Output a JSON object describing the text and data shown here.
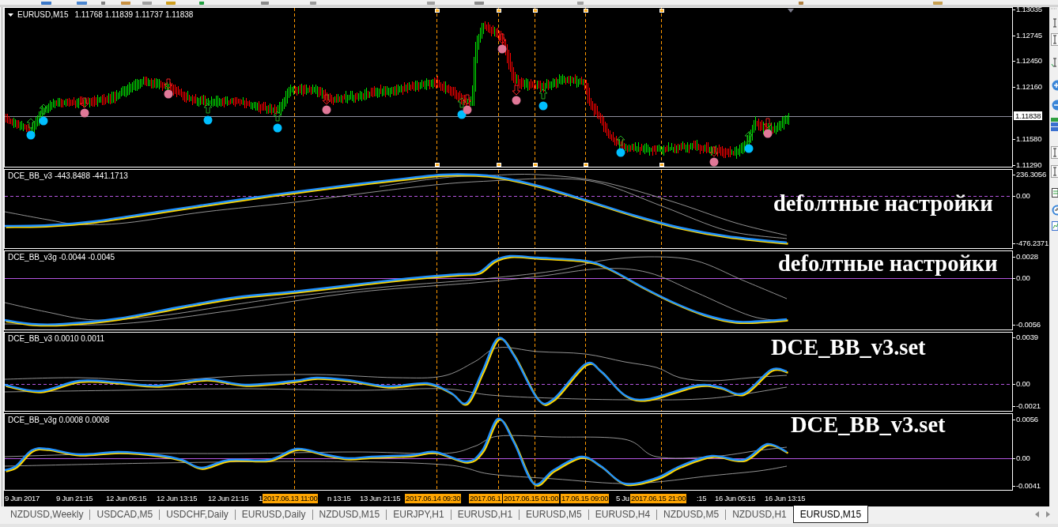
{
  "chart": {
    "panes": [
      {
        "kind": "price",
        "title": "EURUSD,M15",
        "quote": "1.11768 1.11839 1.11737 1.11838",
        "axis_labels": [
          "1.13035",
          "1.12745",
          "1.12450",
          "1.12160",
          "1.11580",
          "1.11290"
        ],
        "current_price": "1.11838"
      },
      {
        "kind": "indicator",
        "title": "DCE_BB_v3 -443.8488 -441.1713",
        "note": "defoлтные настройки",
        "axis_labels": [
          "236.3056",
          "0.00",
          "-476.2371"
        ],
        "zero_line_dashed": true
      },
      {
        "kind": "indicator",
        "title": "DCE_BB_v3g -0.0044 -0.0045",
        "note": "defoлтные настройки",
        "axis_labels": [
          "0.0028",
          "0.00",
          "-0.0056"
        ],
        "zero_line_dashed": false
      },
      {
        "kind": "indicator",
        "title": "DCE_BB_v3 0.0010 0.0011",
        "note": "DCE_BB_v3.set",
        "axis_labels": [
          "0.0039",
          "0.00",
          "-0.0021"
        ],
        "zero_line_dashed": true
      },
      {
        "kind": "indicator",
        "title": "DCE_BB_v3g 0.0008 0.0008",
        "note": "DCE_BB_v3.set",
        "axis_labels": [
          "0.0056",
          "0.00",
          "-0.0041"
        ],
        "zero_line_dashed": false
      }
    ],
    "time_axis": [
      {
        "label": "9 Jun 2017",
        "highlighted": false
      },
      {
        "label": "9 Jun 21:15",
        "highlighted": false
      },
      {
        "label": "12 Jun 05:15",
        "highlighted": false
      },
      {
        "label": "12 Jun 13:15",
        "highlighted": false
      },
      {
        "label": "12 Jun 21:15",
        "highlighted": false
      },
      {
        "label": "1",
        "highlighted": false
      },
      {
        "label": "2017.06.13 11:00",
        "highlighted": true
      },
      {
        "label": "n 13:15",
        "highlighted": false
      },
      {
        "label": "13 Jun 21:15",
        "highlighted": false
      },
      {
        "label": "2017.06.14 09:30",
        "highlighted": true
      },
      {
        "label": "2017.06.1",
        "highlighted": true
      },
      {
        "label": "2017.06.15 01:00",
        "highlighted": true
      },
      {
        "label": "17.06.15 09:00",
        "highlighted": true
      },
      {
        "label": "5 Ju",
        "highlighted": false
      },
      {
        "label": "2017.06.15 21:00",
        "highlighted": true
      },
      {
        "label": ":15",
        "highlighted": false
      },
      {
        "label": "16 Jun 05:15",
        "highlighted": false
      },
      {
        "label": "16 Jun 13:15",
        "highlighted": false
      }
    ]
  },
  "tabs": [
    {
      "label": "NZDUSD,Weekly",
      "selected": false
    },
    {
      "label": "USDCAD,M5",
      "selected": false
    },
    {
      "label": "USDCHF,Daily",
      "selected": false
    },
    {
      "label": "EURUSD,Daily",
      "selected": false
    },
    {
      "label": "NZDUSD,M15",
      "selected": false
    },
    {
      "label": "EURJPY,H1",
      "selected": false
    },
    {
      "label": "EURUSD,H1",
      "selected": false
    },
    {
      "label": "EURUSD,M5",
      "selected": false
    },
    {
      "label": "EURUSD,H4",
      "selected": false
    },
    {
      "label": "NZDUSD,M5",
      "selected": false
    },
    {
      "label": "NZDUSD,H1",
      "selected": false
    },
    {
      "label": "EURUSD,M15",
      "selected": true
    }
  ]
}
